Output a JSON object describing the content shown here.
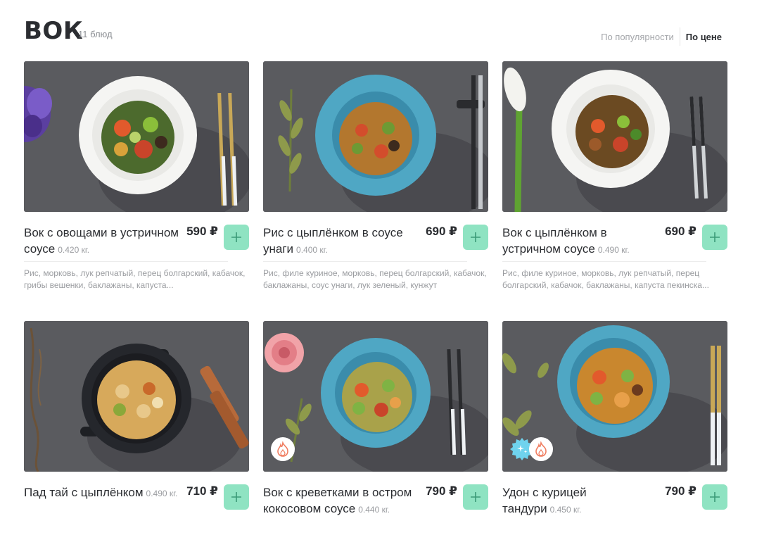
{
  "header": {
    "title": "ВОК",
    "count": "11 блюд",
    "sort_options": [
      {
        "label": "По популярности",
        "active": false
      },
      {
        "label": "По цене",
        "active": true
      }
    ]
  },
  "products": [
    {
      "name": "Вок с овощами в устричном соусе",
      "weight": "0.420 кг.",
      "price": "590 ₽",
      "ingredients": "Рис, морковь, лук репчатый, перец болгарский, кабачок, грибы вешенки, баклажаны, капуста...",
      "plate_color": "#f5f5f3",
      "badges": []
    },
    {
      "name": "Рис с цыплёнком в соусе унаги",
      "weight": "0.400 кг.",
      "price": "690 ₽",
      "ingredients": "Рис, филе куриное, морковь, перец болгарский, кабачок, баклажаны, соус унаги, лук зеленый, кунжут",
      "plate_color": "#4fa7c4",
      "badges": []
    },
    {
      "name": "Вок с цыплёнком в устричном соусе",
      "weight": "0.490 кг.",
      "price": "690 ₽",
      "ingredients": "Рис, филе куриное, морковь, лук репчатый, перец болгарский, кабачок, баклажаны, капуста пекинска...",
      "plate_color": "#f5f5f3",
      "badges": []
    },
    {
      "name": "Пад тай с цыплёнком",
      "weight": "0.490 кг.",
      "price": "710 ₽",
      "ingredients": "",
      "plate_color": "#25272c",
      "badges": []
    },
    {
      "name": "Вок с креветками в остром кокосовом соусе",
      "weight": "0.440 кг.",
      "price": "790 ₽",
      "ingredients": "",
      "plate_color": "#4fa7c4",
      "badges": [
        "spicy-icon"
      ]
    },
    {
      "name": "Удон с курицей тандури",
      "weight": "0.450 кг.",
      "price": "790 ₽",
      "ingredients": "",
      "plate_color": "#4fa7c4",
      "badges": [
        "new-icon",
        "spicy-icon"
      ]
    }
  ],
  "colors": {
    "accent_button": "#8fe3c2",
    "spicy": "#f07d60",
    "new": "#6fd3ee"
  }
}
